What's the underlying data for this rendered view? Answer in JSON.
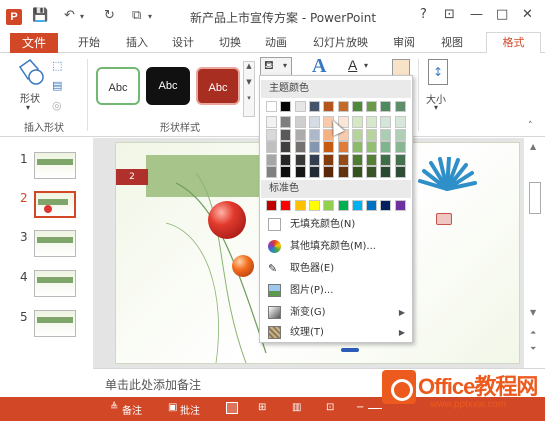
{
  "app": {
    "logo_letter": "P",
    "title": "新产品上市宣传方案 - PowerPoint",
    "window_buttons": {
      "help": "?",
      "restore": "⊡",
      "minimize": "—",
      "maximize": "□",
      "close": "✕"
    }
  },
  "ribbon_tabs": {
    "file": "文件",
    "items": [
      "开始",
      "插入",
      "设计",
      "切换",
      "动画",
      "幻灯片放映",
      "审阅",
      "视图"
    ],
    "active": "格式"
  },
  "ribbon": {
    "shape_label": "形状",
    "insert_shapes_group": "插入形状",
    "shape_styles_group": "形状样式",
    "size_label": "大小",
    "style_sample": "Abc",
    "text_fill_letter": "A"
  },
  "fill_dropdown": {
    "theme_colors_header": "主题颜色",
    "standard_colors_header": "标准色",
    "no_fill": "无填充颜色(N)",
    "more_colors": "其他填充颜色(M)...",
    "eyedropper": "取色器(E)",
    "picture": "图片(P)...",
    "gradient": "渐变(G)",
    "texture": "纹理(T)",
    "theme_top_row": [
      "#ffffff",
      "#000000",
      "#e7e6e6",
      "#44546a",
      "#b5541c",
      "#c46a2a",
      "#4f8a3c",
      "#6b9b4a",
      "#4d8a5e",
      "#5e8e6a"
    ],
    "theme_columns": [
      [
        "#f2f2f2",
        "#d9d9d9",
        "#bfbfbf",
        "#a6a6a6",
        "#808080"
      ],
      [
        "#7f7f7f",
        "#595959",
        "#404040",
        "#262626",
        "#0d0d0d"
      ],
      [
        "#d0cece",
        "#aeabab",
        "#767171",
        "#3a3838",
        "#171616"
      ],
      [
        "#d6dce4",
        "#adb9ca",
        "#8497b0",
        "#333f50",
        "#222a35"
      ],
      [
        "#f8cbad",
        "#f4b183",
        "#c55a11",
        "#843c0c",
        "#5a2808"
      ],
      [
        "#fbe5d6",
        "#f8cbad",
        "#e07b39",
        "#964b16",
        "#64320e"
      ],
      [
        "#d5e8c4",
        "#b4d49a",
        "#8cbb6a",
        "#4e7c30",
        "#34531f"
      ],
      [
        "#d8e8cc",
        "#b7d49e",
        "#94bf73",
        "#567f38",
        "#395526"
      ],
      [
        "#d3e6d8",
        "#a9ceb3",
        "#7fb58e",
        "#3c6f48",
        "#284a30"
      ],
      [
        "#d7e7da",
        "#b0cfb6",
        "#89b792",
        "#467250",
        "#2f4c35"
      ]
    ],
    "standard_row": [
      "#c00000",
      "#ff0000",
      "#ffc000",
      "#ffff00",
      "#92d050",
      "#00b050",
      "#00b0f0",
      "#0070c0",
      "#002060",
      "#7030a0"
    ]
  },
  "slides": {
    "numbers": [
      "1",
      "2",
      "3",
      "4",
      "5"
    ],
    "selected": "2",
    "tab_number": "2"
  },
  "notes": {
    "placeholder": "单击此处添加备注"
  },
  "status": {
    "notes_label": "备注",
    "comments_label": "批注"
  },
  "watermark": {
    "brand": "Office教程网",
    "url": "www.pptxxw.com"
  }
}
